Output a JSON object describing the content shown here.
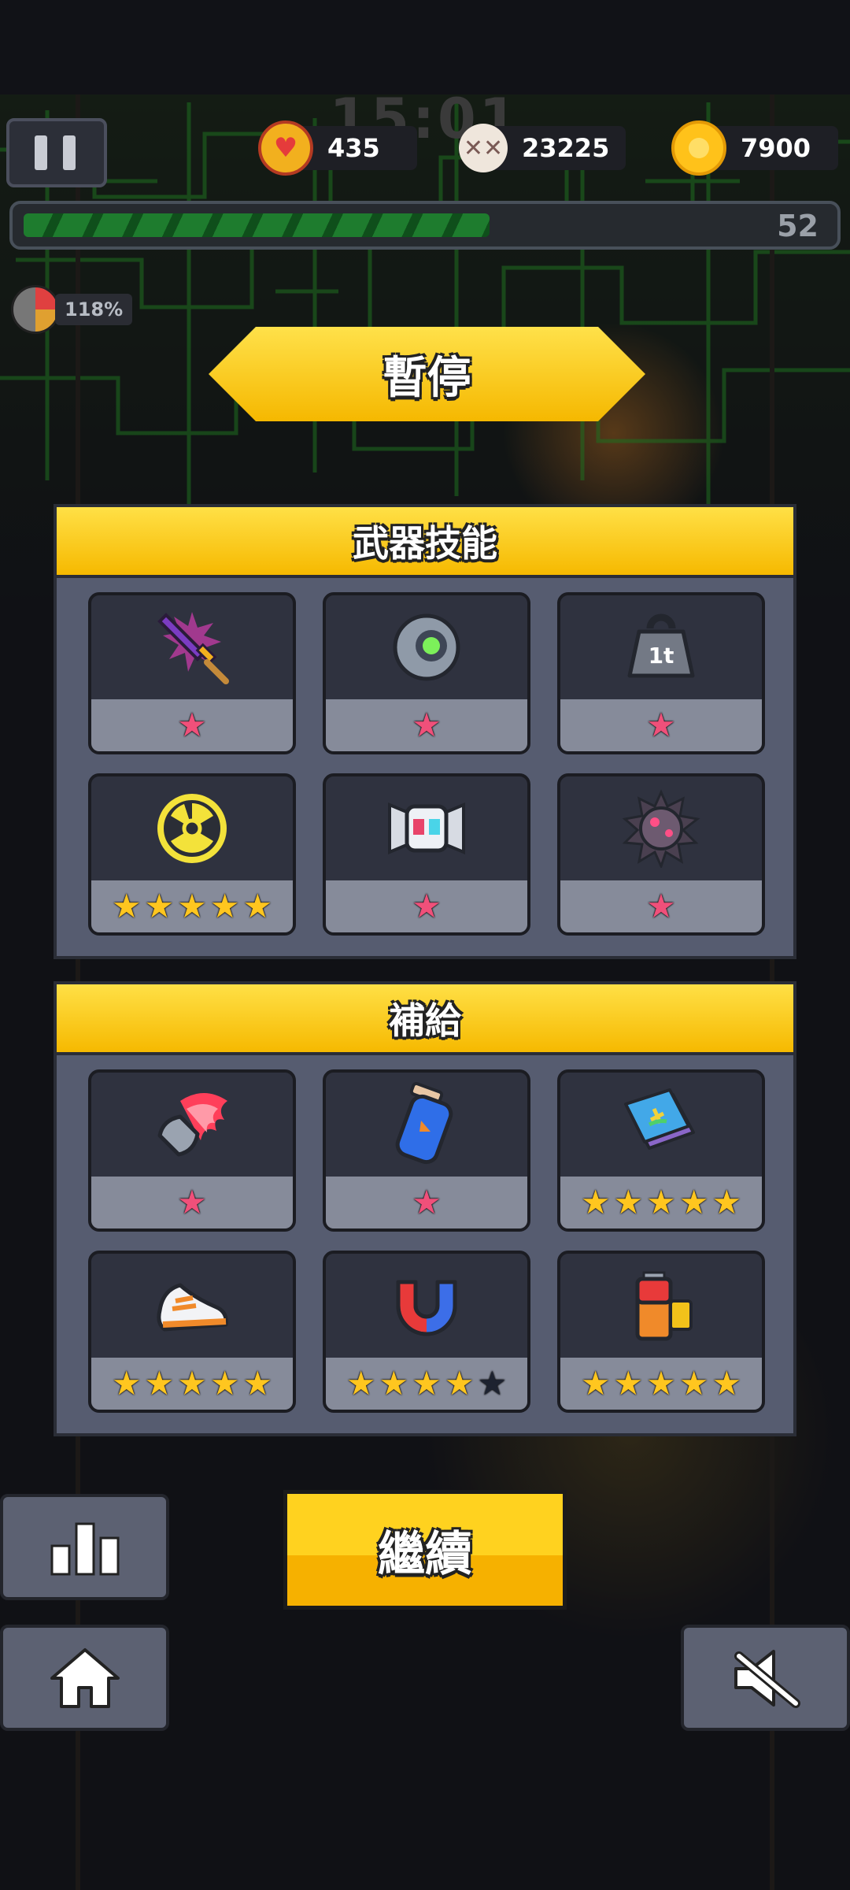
{
  "hud": {
    "timer": "15:01",
    "hp": "435",
    "kills": "23225",
    "coins": "7900",
    "level": "52",
    "xp_fraction": 0.58,
    "speed": "118%"
  },
  "title": "暫停",
  "weapons": {
    "header": "武器技能",
    "items": [
      {
        "icon": "purple-sword-icon",
        "stars": 1,
        "max": 1,
        "star_color": "pink"
      },
      {
        "icon": "orb-drone-icon",
        "stars": 1,
        "max": 1,
        "star_color": "pink"
      },
      {
        "icon": "weight-1t-icon",
        "weight_label": "1t",
        "stars": 1,
        "max": 1,
        "star_color": "pink"
      },
      {
        "icon": "radiation-disc-icon",
        "stars": 5,
        "max": 5,
        "star_color": "gold"
      },
      {
        "icon": "robot-helmet-icon",
        "stars": 1,
        "max": 1,
        "star_color": "pink"
      },
      {
        "icon": "spiked-mine-icon",
        "stars": 1,
        "max": 1,
        "star_color": "pink"
      }
    ]
  },
  "supplies": {
    "header": "補給",
    "items": [
      {
        "icon": "flaming-bullet-icon",
        "stars": 1,
        "max": 1,
        "star_color": "pink"
      },
      {
        "icon": "energy-can-icon",
        "stars": 1,
        "max": 1,
        "star_color": "pink"
      },
      {
        "icon": "book-icon",
        "stars": 5,
        "max": 5,
        "star_color": "gold"
      },
      {
        "icon": "sneaker-icon",
        "stars": 5,
        "max": 5,
        "star_color": "gold"
      },
      {
        "icon": "magnet-icon",
        "stars": 4,
        "max": 5,
        "star_color": "gold"
      },
      {
        "icon": "battery-icon",
        "stars": 5,
        "max": 5,
        "star_color": "gold"
      }
    ]
  },
  "buttons": {
    "continue": "繼續",
    "stats_icon": "bar-chart-icon",
    "home_icon": "home-icon",
    "mute_icon": "sound-off-icon"
  },
  "colors": {
    "accent_yellow": "#ffd21f",
    "panel": "#565c70",
    "star_pink": "#f0507a",
    "star_gold": "#ffc61f"
  }
}
